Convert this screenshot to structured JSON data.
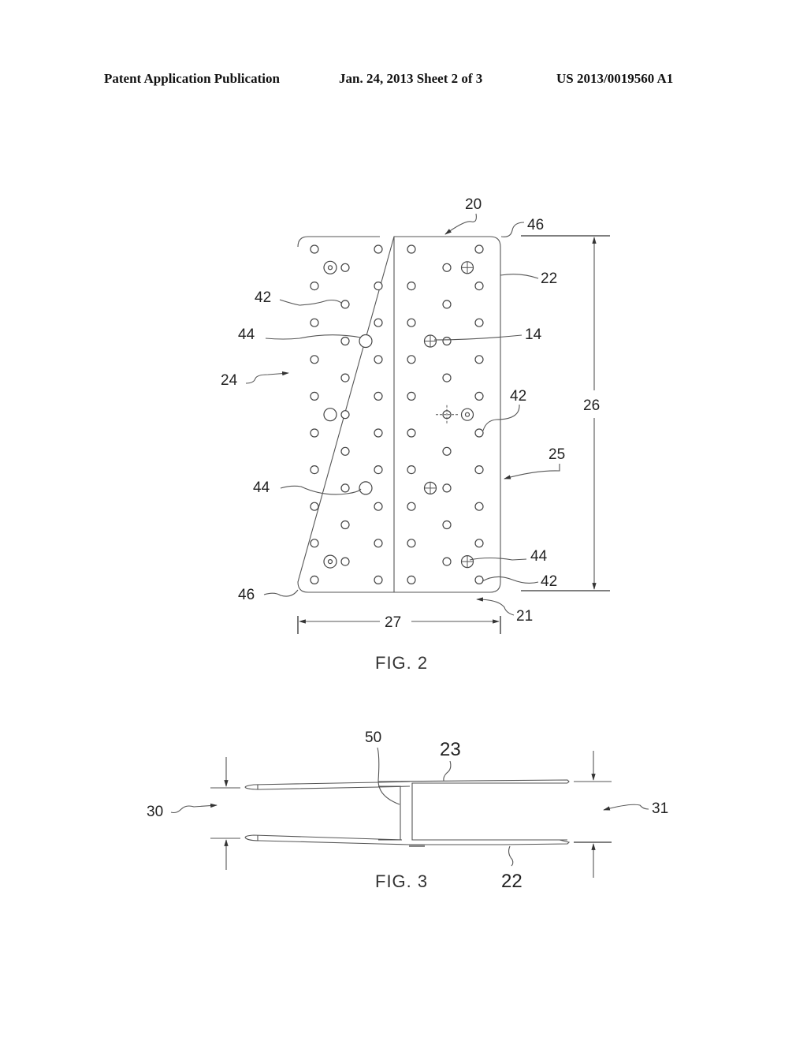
{
  "header": {
    "publication_type": "Patent Application Publication",
    "date_sheet": "Jan. 24, 2013   Sheet 2 of 3",
    "publication_number": "US 2013/0019560 A1"
  },
  "figures": [
    {
      "caption": "FIG. 2",
      "view": "plan view of perforated panel",
      "reference_labels": {
        "top_edge": "20",
        "bottom_edge": "21",
        "right_side_edge": "22",
        "left_region": "24",
        "right_region": "25",
        "height_dimension": "26",
        "width_dimension": "27",
        "corner_top": "46",
        "corner_bottom": "46",
        "hole_label_left": "42",
        "large_hole_upper": "44",
        "large_hole_lower": "44",
        "fastener_hole": "14",
        "hole_label_right": "42",
        "fastener_lower_right": "44",
        "hole_bottom_right": "42"
      }
    },
    {
      "caption": "FIG. 3",
      "view": "edge/cross-section view",
      "reference_labels": {
        "left_opening": "30",
        "right_opening": "31",
        "web": "50",
        "top_flange": "23",
        "bottom_flange": "22"
      }
    }
  ]
}
